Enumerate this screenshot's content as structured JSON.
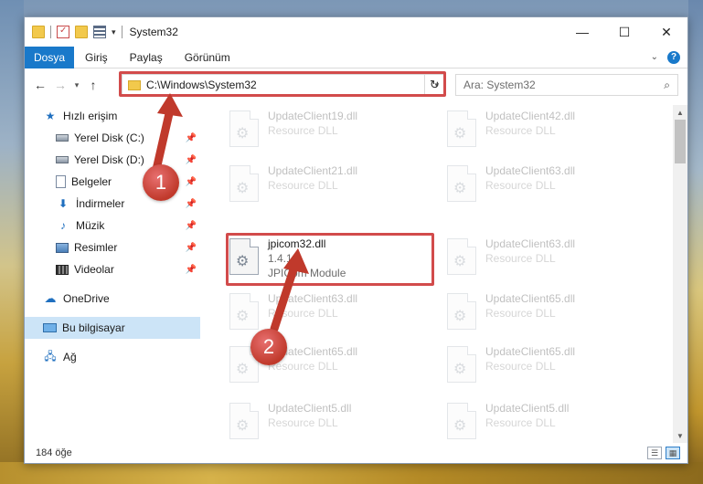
{
  "window": {
    "title": "System32",
    "controls": {
      "minimize": "—",
      "maximize": "☐",
      "close": "✕"
    }
  },
  "ribbon": {
    "file_tab": "Dosya",
    "tabs": [
      "Giriş",
      "Paylaş",
      "Görünüm"
    ]
  },
  "address": {
    "path": "C:\\Windows\\System32"
  },
  "search": {
    "placeholder": "Ara: System32"
  },
  "sidebar": {
    "quick_access": "Hızlı erişim",
    "items": [
      {
        "label": "Yerel Disk (C:)",
        "icon": "disk-icon"
      },
      {
        "label": "Yerel Disk (D:)",
        "icon": "disk-icon"
      },
      {
        "label": "Belgeler",
        "icon": "documents-icon"
      },
      {
        "label": "İndirmeler",
        "icon": "downloads-icon"
      },
      {
        "label": "Müzik",
        "icon": "music-icon"
      },
      {
        "label": "Resimler",
        "icon": "pictures-icon"
      },
      {
        "label": "Videolar",
        "icon": "videos-icon"
      }
    ],
    "onedrive": "OneDrive",
    "this_pc": "Bu bilgisayar",
    "network": "Ağ"
  },
  "files": [
    {
      "name": "UpdateClient19.dll",
      "sub": "Resource DLL"
    },
    {
      "name": "UpdateClient42.dll",
      "sub": "Resource DLL"
    },
    {
      "name": "UpdateClient21.dll",
      "sub": "Resource DLL"
    },
    {
      "name": "UpdateClient63.dll",
      "sub": "Resource DLL"
    },
    {
      "name": "jpicom32.dll",
      "sub": "1.4.1.0",
      "sub2": "JPICom Module"
    },
    {
      "name": "UpdateClient63.dll",
      "sub": "Resource DLL"
    },
    {
      "name": "UpdateClient63.dll",
      "sub": "Resource DLL"
    },
    {
      "name": "UpdateClient65.dll",
      "sub": "Resource DLL"
    },
    {
      "name": "UpdateClient65.dll",
      "sub": "Resource DLL"
    },
    {
      "name": "UpdateClient65.dll",
      "sub": "Resource DLL"
    },
    {
      "name": "UpdateClient5.dll",
      "sub": "Resource DLL"
    },
    {
      "name": "UpdateClient5.dll",
      "sub": "Resource DLL"
    }
  ],
  "status": {
    "count": "184 öğe"
  },
  "callouts": [
    "1",
    "2"
  ],
  "colors": {
    "accent": "#1979ca",
    "highlight": "#d24b4b",
    "selected": "#cce4f7"
  }
}
